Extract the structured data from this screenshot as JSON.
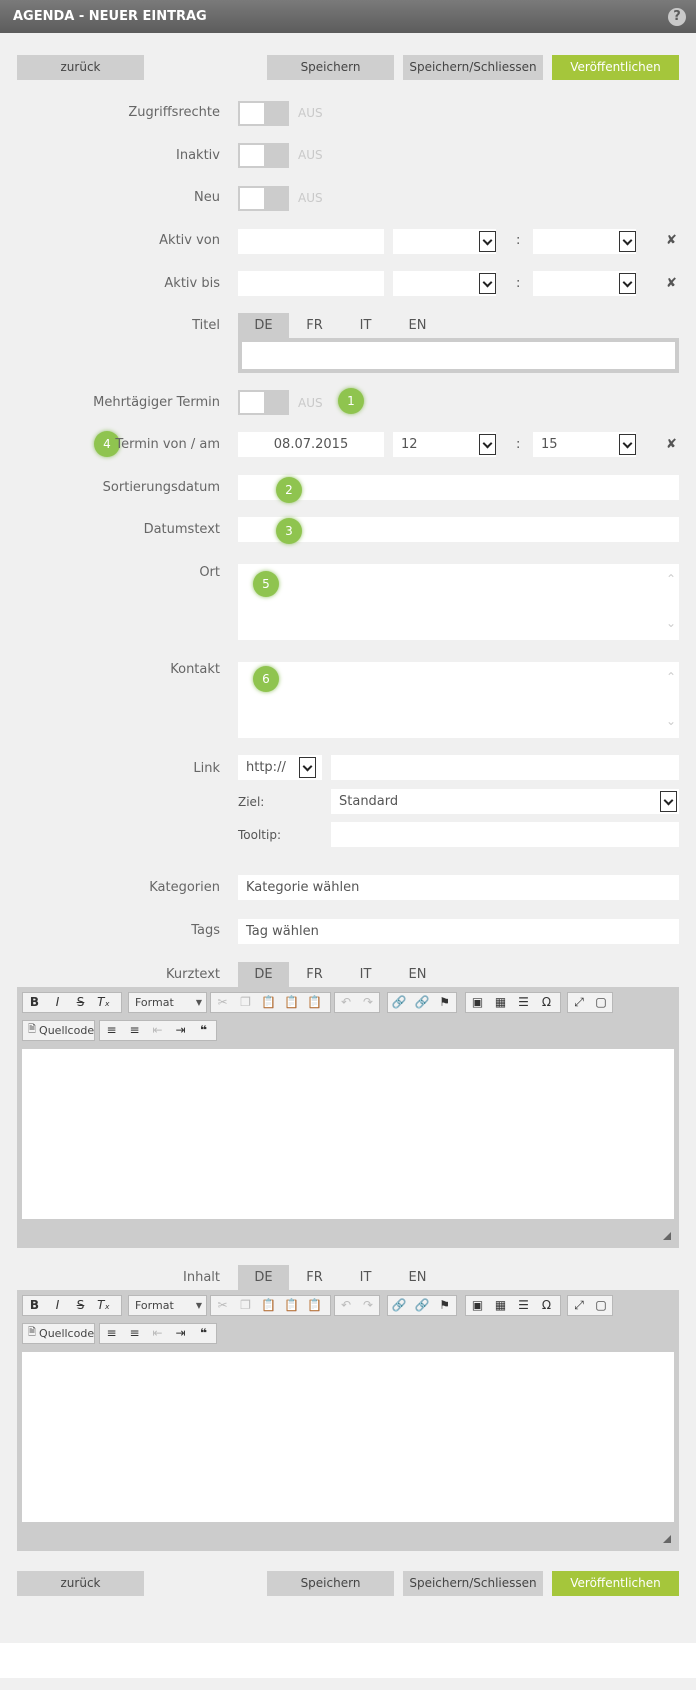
{
  "header": {
    "title": "AGENDA - NEUER EINTRAG",
    "help": "?"
  },
  "buttons": {
    "back": "zurück",
    "save": "Speichern",
    "save_close": "Speichern/Schliessen",
    "publish": "Veröffentlichen"
  },
  "toggles": {
    "off": "AUS"
  },
  "labels": {
    "access": "Zugriffsrechte",
    "inactive": "Inaktiv",
    "new": "Neu",
    "active_from": "Aktiv von",
    "active_to": "Aktiv bis",
    "title": "Titel",
    "multiday": "Mehrtägiger Termin",
    "date": "Termin von / am",
    "sortdate": "Sortierungsdatum",
    "datetext": "Datumstext",
    "place": "Ort",
    "contact": "Kontakt",
    "link": "Link",
    "target": "Ziel:",
    "tooltip": "Tooltip:",
    "categories": "Kategorien",
    "tags": "Tags",
    "shorttext": "Kurztext",
    "content": "Inhalt"
  },
  "tabs": [
    "DE",
    "FR",
    "IT",
    "EN"
  ],
  "time_sep": ":",
  "clear": "✘",
  "date_values": {
    "date": "08.07.2015",
    "hour": "12",
    "minute": "15"
  },
  "link": {
    "protocol": "http://",
    "target": "Standard"
  },
  "placeholders": {
    "categories": "Kategorie wählen",
    "tags": "Tag wählen"
  },
  "badges": [
    "1",
    "2",
    "3",
    "4",
    "5",
    "6"
  ],
  "editor": {
    "format": "Format",
    "source": "Quellcode"
  },
  "colors": {
    "accent": "#a5c63b",
    "badge": "#8fc44f",
    "titlebar": "#666666"
  }
}
